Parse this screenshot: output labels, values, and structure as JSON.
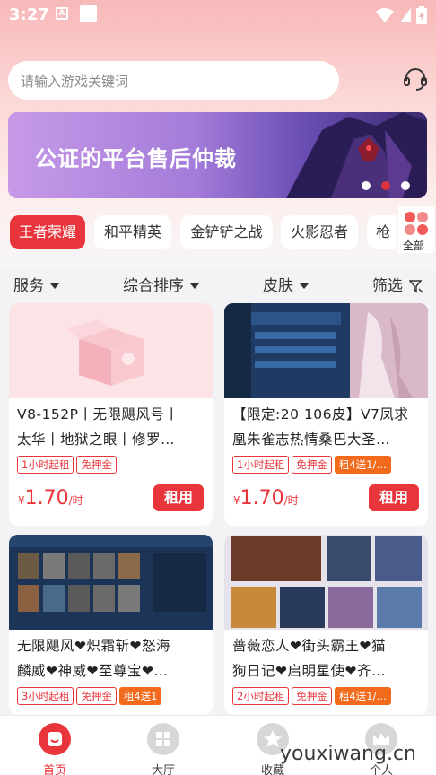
{
  "status": {
    "time": "3:27",
    "a_icon": "A"
  },
  "search": {
    "placeholder": "请输入游戏关键词"
  },
  "banner": {
    "text": "公证的平台售后仲裁"
  },
  "categories": [
    "王者荣耀",
    "和平精英",
    "金铲铲之战",
    "火影忍者",
    "枪"
  ],
  "all_categories_label": "全部",
  "filters": [
    "服务",
    "综合排序",
    "皮肤",
    "筛选"
  ],
  "cards": [
    {
      "title_line1": "V8-152P丨无限飓风号丨",
      "title_line2": "太华丨地狱之眼丨修罗…",
      "tags": [
        "1小时起租",
        "免押金"
      ],
      "promo": "",
      "currency": "¥",
      "price": "1.70",
      "unit": "/时",
      "button": "租用"
    },
    {
      "title_line1": "【限定:20 106皮】V7凤求",
      "title_line2": "凰朱雀志热情桑巴大圣…",
      "tags": [
        "1小时起租",
        "免押金"
      ],
      "promo": "租4送1/…",
      "currency": "¥",
      "price": "1.70",
      "unit": "/时",
      "button": "租用"
    },
    {
      "title_line1": "无限飓风❤炽霜斩❤怒海",
      "title_line2": "麟威❤神威❤至尊宝❤…",
      "tags": [
        "3小时起租",
        "免押金"
      ],
      "promo": "租4送1"
    },
    {
      "title_line1": "蔷薇恋人❤街头霸王❤猫",
      "title_line2": "狗日记❤启明星使❤齐…",
      "tags": [
        "2小时起租",
        "免押金"
      ],
      "promo": "租4送1/…"
    }
  ],
  "nav": [
    {
      "label": "首页",
      "icon": "home-icon",
      "active": true
    },
    {
      "label": "大厅",
      "icon": "grid-icon",
      "active": false
    },
    {
      "label": "收藏",
      "icon": "star-icon",
      "active": false
    },
    {
      "label": "个人",
      "icon": "crown-icon",
      "active": false
    }
  ],
  "watermark": "youxiwang.cn",
  "colors": {
    "accent": "#e8343b",
    "promo": "#f26a1b"
  }
}
